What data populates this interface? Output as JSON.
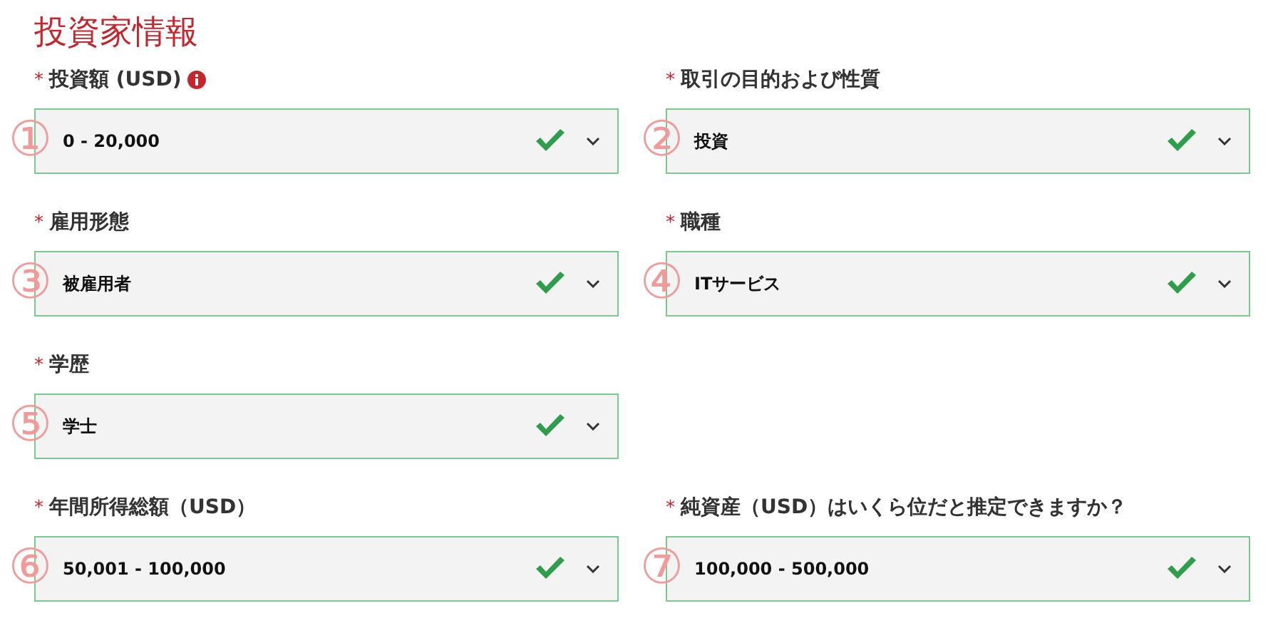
{
  "title": "投資家情報",
  "rows": [
    {
      "fields": [
        {
          "required_mark": "*",
          "label": "投資額 (USD)",
          "info": true,
          "marker": "①",
          "value": "0 - 20,000",
          "valid": true
        },
        {
          "required_mark": "*",
          "label": "取引の目的および性質",
          "marker": "②",
          "value": "投資",
          "valid": true
        }
      ]
    },
    {
      "fields": [
        {
          "required_mark": "*",
          "label": "雇用形態",
          "marker": "③",
          "value": "被雇用者",
          "valid": true
        },
        {
          "required_mark": "*",
          "label": "職種",
          "marker": "④",
          "value": "ITサービス",
          "valid": true
        }
      ]
    },
    {
      "fields": [
        {
          "required_mark": "*",
          "label": "学歴",
          "marker": "⑤",
          "value": "学士",
          "valid": true
        }
      ]
    },
    {
      "fields": [
        {
          "required_mark": "*",
          "label": "年間所得総額（USD）",
          "marker": "⑥",
          "value": "50,001 - 100,000",
          "valid": true
        },
        {
          "required_mark": "*",
          "label": "純資産（USD）はいくら位だと推定できますか？",
          "marker": "⑦",
          "value": "100,000 - 500,000",
          "valid": true
        }
      ]
    }
  ]
}
